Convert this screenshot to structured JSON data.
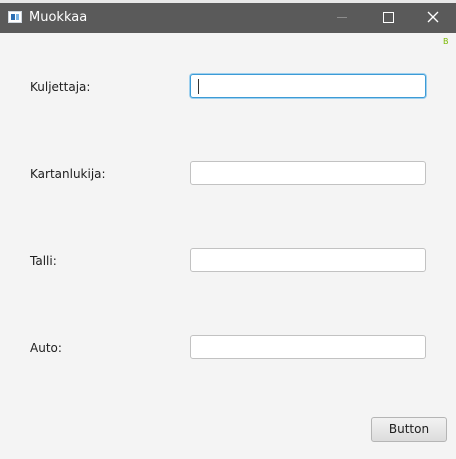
{
  "window": {
    "title": "Muokkaa",
    "icon": "app-window-icon",
    "controls": [
      "minimize-icon",
      "maximize-icon",
      "close-icon"
    ],
    "titlebar_color": "#5a5a5a",
    "corner_mark": "B"
  },
  "form": {
    "fields": [
      {
        "label": "Kuljettaja:",
        "value": "",
        "focused": true
      },
      {
        "label": "Kartanlukija:",
        "value": ""
      },
      {
        "label": "Talli:",
        "value": ""
      },
      {
        "label": "Auto:",
        "value": ""
      }
    ],
    "focus_color": "#3c9bd6",
    "button_label": "Button"
  }
}
